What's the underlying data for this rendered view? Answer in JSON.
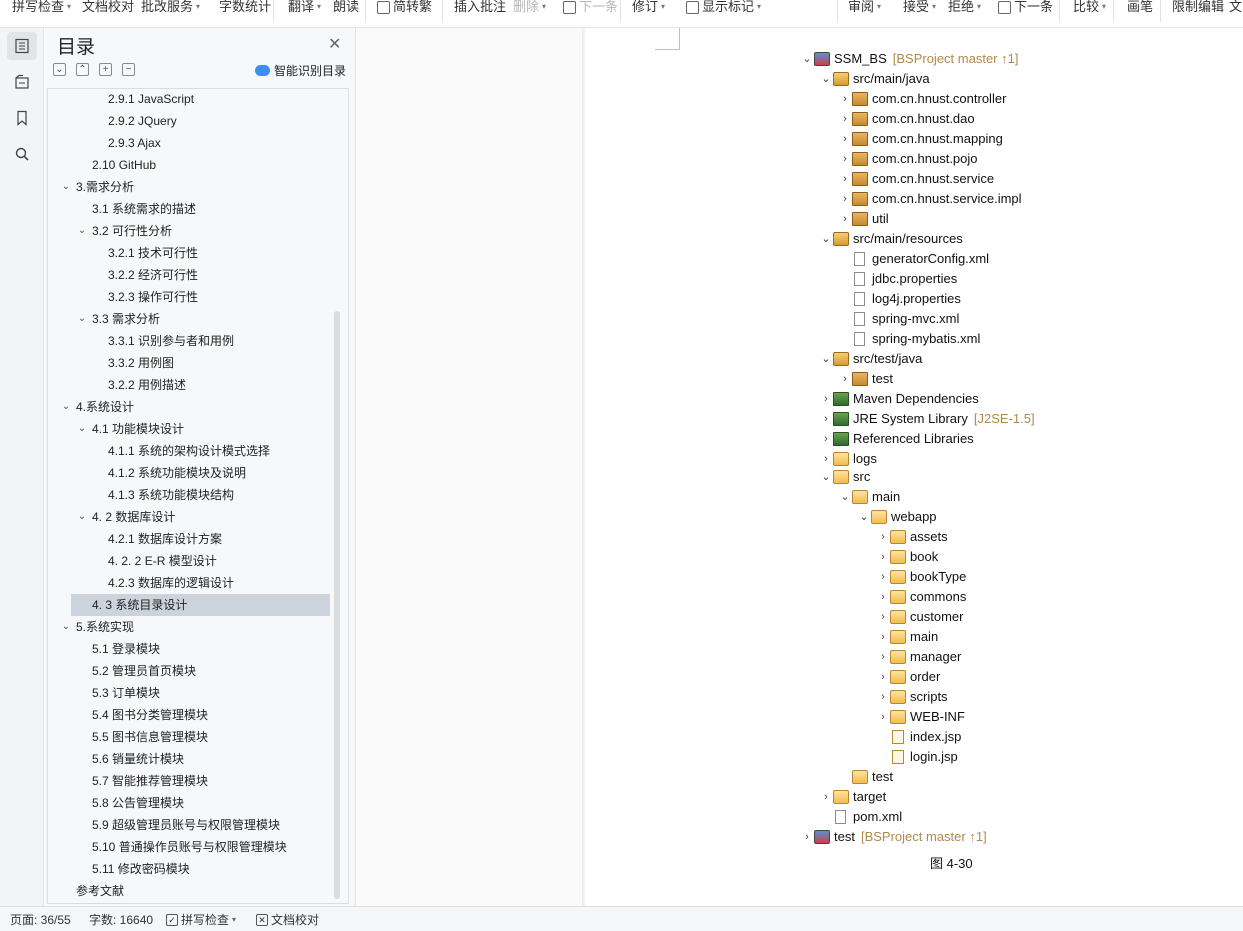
{
  "toolbar": {
    "items": [
      {
        "label": "拼写检查",
        "caret": true
      },
      {
        "label": "文档校对",
        "caret": false
      },
      {
        "label": "批改服务",
        "caret": true
      },
      {
        "label": "字数统计",
        "caret": false
      },
      {
        "label": "翻译",
        "caret": true
      },
      {
        "label": "朗读",
        "caret": false
      },
      {
        "label": "简转繁",
        "caret": false
      },
      {
        "label": "插入批注",
        "caret": false
      },
      {
        "label": "删除",
        "caret": true
      },
      {
        "label": "下一条",
        "caret": false
      },
      {
        "label": "修订",
        "caret": true
      },
      {
        "label": "显示标记",
        "caret": true
      },
      {
        "label": "审阅",
        "caret": true
      },
      {
        "label": "接受",
        "caret": true
      },
      {
        "label": "拒绝",
        "caret": true
      },
      {
        "label": "下一条",
        "caret": false
      },
      {
        "label": "比较",
        "caret": true
      },
      {
        "label": "画笔",
        "caret": false
      },
      {
        "label": "限制编辑",
        "caret": false
      },
      {
        "label": "文",
        "caret": false
      }
    ]
  },
  "rail": {
    "icons": [
      "toc-icon",
      "nav-icon",
      "bookmark-icon",
      "search-icon"
    ]
  },
  "toc": {
    "title": "目录",
    "smart_label": "智能识别目录",
    "items": [
      {
        "text": "2.9.1 JavaScript",
        "level": 3
      },
      {
        "text": "2.9.2 JQuery",
        "level": 3
      },
      {
        "text": "2.9.3 Ajax",
        "level": 3
      },
      {
        "text": "2.10 GitHub",
        "level": 2
      },
      {
        "text": "3.需求分析",
        "level": 1,
        "expanded": true
      },
      {
        "text": "3.1  系统需求的描述",
        "level": 2
      },
      {
        "text": "3.2  可行性分析",
        "level": 2,
        "expanded": true
      },
      {
        "text": "3.2.1 技术可行性",
        "level": 3
      },
      {
        "text": "3.2.2 经济可行性",
        "level": 3
      },
      {
        "text": "3.2.3 操作可行性",
        "level": 3
      },
      {
        "text": "3.3  需求分析",
        "level": 2,
        "expanded": true
      },
      {
        "text": "3.3.1  识别参与者和用例",
        "level": 3
      },
      {
        "text": "3.3.2  用例图",
        "level": 3
      },
      {
        "text": "3.2.2 用例描述",
        "level": 3
      },
      {
        "text": "4.系统设计",
        "level": 1,
        "expanded": true
      },
      {
        "text": "4.1 功能模块设计",
        "level": 2,
        "expanded": true
      },
      {
        "text": "4.1.1 系统的架构设计模式选择",
        "level": 3
      },
      {
        "text": "4.1.2 系统功能模块及说明",
        "level": 3
      },
      {
        "text": "4.1.3 系统功能模块结构",
        "level": 3
      },
      {
        "text": "4. 2 数据库设计",
        "level": 2,
        "expanded": true
      },
      {
        "text": "4.2.1 数据库设计方案",
        "level": 3
      },
      {
        "text": "4. 2. 2 E-R 模型设计",
        "level": 3
      },
      {
        "text": "4.2.3 数据库的逻辑设计",
        "level": 3
      },
      {
        "text": "4. 3  系统目录设计",
        "level": 2,
        "selected": true
      },
      {
        "text": "5.系统实现",
        "level": 1,
        "expanded": true
      },
      {
        "text": "5.1  登录模块",
        "level": 2
      },
      {
        "text": "5.2  管理员首页模块",
        "level": 2
      },
      {
        "text": "5.3  订单模块",
        "level": 2
      },
      {
        "text": "5.4  图书分类管理模块",
        "level": 2
      },
      {
        "text": "5.5  图书信息管理模块",
        "level": 2
      },
      {
        "text": "5.6  销量统计模块",
        "level": 2
      },
      {
        "text": "5.7  智能推荐管理模块",
        "level": 2
      },
      {
        "text": "5.8  公告管理模块",
        "level": 2
      },
      {
        "text": "5.9  超级管理员账号与权限管理模块",
        "level": 2
      },
      {
        "text": "5.10  普通操作员账号与权限管理模块",
        "level": 2
      },
      {
        "text": "5.11  修改密码模块",
        "level": 2
      },
      {
        "text": "参考文献",
        "level": 1
      }
    ]
  },
  "tree": {
    "rows": [
      {
        "text": "SSM_BS",
        "decor": "[BSProject master ↑1]",
        "indent": 0,
        "chev": "v",
        "icon": "project"
      },
      {
        "text": "src/main/java",
        "indent": 1,
        "chev": "v",
        "icon": "srcfolder"
      },
      {
        "text": "com.cn.hnust.controller",
        "indent": 2,
        "chev": ">",
        "icon": "package"
      },
      {
        "text": "com.cn.hnust.dao",
        "indent": 2,
        "chev": ">",
        "icon": "package"
      },
      {
        "text": "com.cn.hnust.mapping",
        "indent": 2,
        "chev": ">",
        "icon": "package"
      },
      {
        "text": "com.cn.hnust.pojo",
        "indent": 2,
        "chev": ">",
        "icon": "package"
      },
      {
        "text": "com.cn.hnust.service",
        "indent": 2,
        "chev": ">",
        "icon": "package"
      },
      {
        "text": "com.cn.hnust.service.impl",
        "indent": 2,
        "chev": ">",
        "icon": "package"
      },
      {
        "text": "util",
        "indent": 2,
        "chev": ">",
        "icon": "package"
      },
      {
        "text": "src/main/resources",
        "indent": 1,
        "chev": "v",
        "icon": "srcfolder"
      },
      {
        "text": "generatorConfig.xml",
        "indent": 2,
        "chev": "",
        "icon": "xml"
      },
      {
        "text": "jdbc.properties",
        "indent": 2,
        "chev": "",
        "icon": "file"
      },
      {
        "text": "log4j.properties",
        "indent": 2,
        "chev": "",
        "icon": "file"
      },
      {
        "text": "spring-mvc.xml",
        "indent": 2,
        "chev": "",
        "icon": "xml"
      },
      {
        "text": "spring-mybatis.xml",
        "indent": 2,
        "chev": "",
        "icon": "xml"
      },
      {
        "text": "src/test/java",
        "indent": 1,
        "chev": "v",
        "icon": "srcfolder"
      },
      {
        "text": "test",
        "indent": 2,
        "chev": ">",
        "icon": "package"
      },
      {
        "text": "Maven Dependencies",
        "indent": 1,
        "chev": ">",
        "icon": "library"
      },
      {
        "text": "JRE System Library",
        "decor": "[J2SE-1.5]",
        "indent": 1,
        "chev": ">",
        "icon": "library"
      },
      {
        "text": "Referenced Libraries",
        "indent": 1,
        "chev": ">",
        "icon": "library"
      },
      {
        "text": "logs",
        "indent": 1,
        "chev": ">",
        "icon": "folder"
      },
      {
        "text": "src",
        "indent": 1,
        "chev": "v",
        "icon": "folder"
      },
      {
        "text": "main",
        "indent": 2,
        "chev": "v",
        "icon": "folder"
      },
      {
        "text": "webapp",
        "indent": 3,
        "chev": "v",
        "icon": "folder"
      },
      {
        "text": "assets",
        "indent": 4,
        "chev": ">",
        "icon": "folder"
      },
      {
        "text": "book",
        "indent": 4,
        "chev": ">",
        "icon": "folder"
      },
      {
        "text": "bookType",
        "indent": 4,
        "chev": ">",
        "icon": "folder"
      },
      {
        "text": "commons",
        "indent": 4,
        "chev": ">",
        "icon": "folder"
      },
      {
        "text": "customer",
        "indent": 4,
        "chev": ">",
        "icon": "folder"
      },
      {
        "text": "main",
        "indent": 4,
        "chev": ">",
        "icon": "folder"
      },
      {
        "text": "manager",
        "indent": 4,
        "chev": ">",
        "icon": "folder"
      },
      {
        "text": "order",
        "indent": 4,
        "chev": ">",
        "icon": "folder"
      },
      {
        "text": "scripts",
        "indent": 4,
        "chev": ">",
        "icon": "folder"
      },
      {
        "text": "WEB-INF",
        "indent": 4,
        "chev": ">",
        "icon": "folder"
      },
      {
        "text": "index.jsp",
        "indent": 4,
        "chev": "",
        "icon": "jsp"
      },
      {
        "text": "login.jsp",
        "indent": 4,
        "chev": "",
        "icon": "jsp"
      },
      {
        "text": "test",
        "indent": 2,
        "chev": "",
        "icon": "folder"
      },
      {
        "text": "target",
        "indent": 1,
        "chev": ">",
        "icon": "folder"
      },
      {
        "text": "pom.xml",
        "indent": 1,
        "chev": "",
        "icon": "xml"
      },
      {
        "text": "test",
        "decor": "[BSProject master ↑1]",
        "indent": 0,
        "chev": ">",
        "icon": "project"
      }
    ],
    "caption": "图 4-30"
  },
  "status": {
    "page": "页面: 36/55",
    "words": "字数: 16640",
    "spell": "拼写检查",
    "proof": "文档校对"
  }
}
